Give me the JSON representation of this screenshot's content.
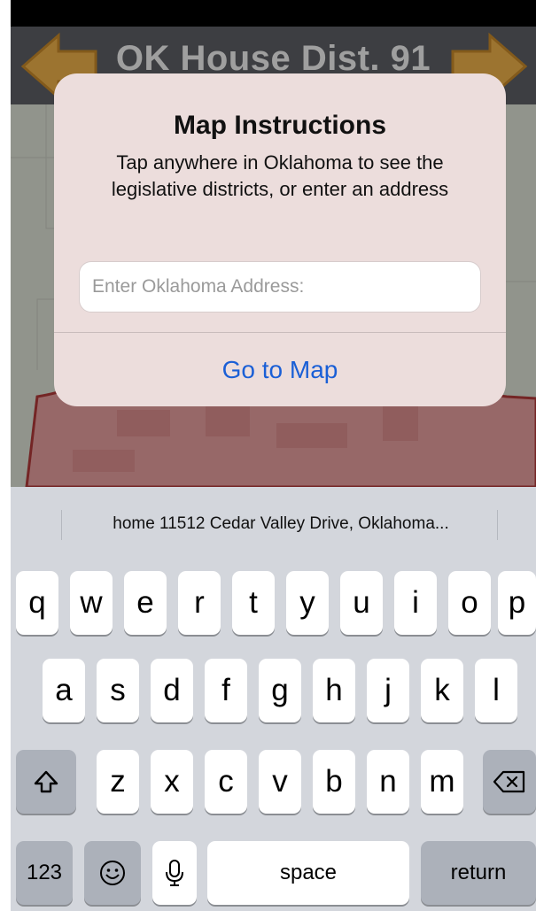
{
  "map": {
    "title": "OK House Dist. 91"
  },
  "dialog": {
    "title": "Map Instructions",
    "message": "Tap anywhere in Oklahoma to see the legislative districts, or enter an address",
    "input_placeholder": "Enter Oklahoma Address:",
    "button_label": "Go to Map"
  },
  "keyboard": {
    "suggestion": "home  11512 Cedar Valley Drive, Oklahoma...",
    "row1": [
      "q",
      "w",
      "e",
      "r",
      "t",
      "y",
      "u",
      "i",
      "o",
      "p"
    ],
    "row2": [
      "a",
      "s",
      "d",
      "f",
      "g",
      "h",
      "j",
      "k",
      "l"
    ],
    "row3": [
      "z",
      "x",
      "c",
      "v",
      "b",
      "n",
      "m"
    ],
    "numbers_label": "123",
    "space_label": "space",
    "return_label": "return",
    "icons": {
      "shift": "shift-icon",
      "delete": "delete-icon",
      "emoji": "emoji-icon",
      "mic": "microphone-icon"
    }
  },
  "colors": {
    "arrow": "#f0b34a",
    "district_fill": "#e8a0a0",
    "link_blue": "#1a5fd6"
  }
}
